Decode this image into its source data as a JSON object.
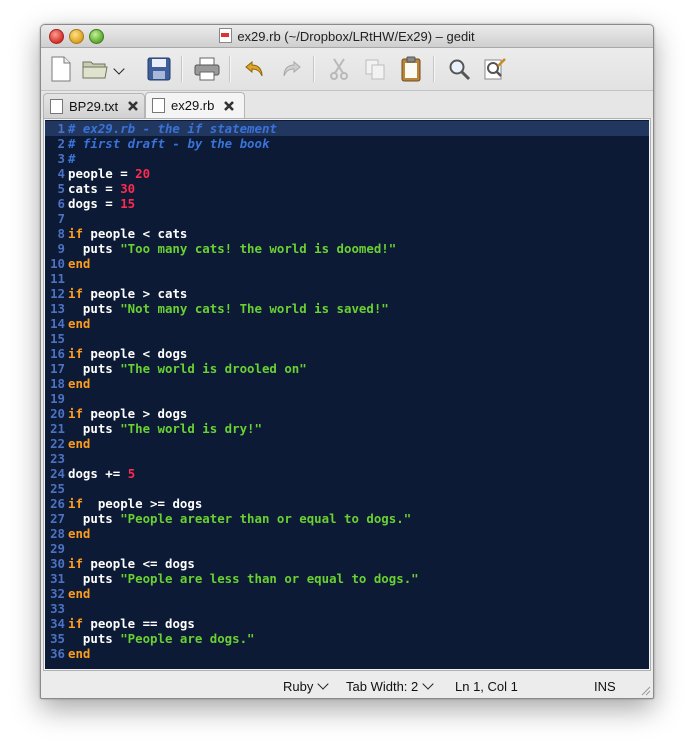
{
  "window": {
    "title": "ex29.rb (~/Dropbox/LRtHW/Ex29) – gedit"
  },
  "toolbar": {
    "buttons": [
      "new-document",
      "open",
      "open-dropdown",
      "save",
      "print",
      "undo",
      "redo",
      "cut",
      "copy",
      "paste",
      "find",
      "find-replace"
    ]
  },
  "tabs": [
    {
      "label": "BP29.txt",
      "active": false
    },
    {
      "label": "ex29.rb",
      "active": true
    }
  ],
  "editor": {
    "current_line": 1,
    "lines": [
      [
        [
          "c",
          "# ex29.rb - the if statement"
        ]
      ],
      [
        [
          "c",
          "# first draft - by the book"
        ]
      ],
      [
        [
          "c",
          "#"
        ]
      ],
      [
        [
          "i",
          "people = "
        ],
        [
          "n",
          "20"
        ]
      ],
      [
        [
          "i",
          "cats = "
        ],
        [
          "n",
          "30"
        ]
      ],
      [
        [
          "i",
          "dogs = "
        ],
        [
          "n",
          "15"
        ]
      ],
      [],
      [
        [
          "k",
          "if"
        ],
        [
          "i",
          " people < cats"
        ]
      ],
      [
        [
          "i",
          "  puts "
        ],
        [
          "s",
          "\"Too many cats! the world is doomed!\""
        ]
      ],
      [
        [
          "k",
          "end"
        ]
      ],
      [],
      [
        [
          "k",
          "if"
        ],
        [
          "i",
          " people > cats"
        ]
      ],
      [
        [
          "i",
          "  puts "
        ],
        [
          "s",
          "\"Not many cats! The world is saved!\""
        ]
      ],
      [
        [
          "k",
          "end"
        ]
      ],
      [],
      [
        [
          "k",
          "if"
        ],
        [
          "i",
          " people < dogs"
        ]
      ],
      [
        [
          "i",
          "  puts "
        ],
        [
          "s",
          "\"The world is drooled on\""
        ]
      ],
      [
        [
          "k",
          "end"
        ]
      ],
      [],
      [
        [
          "k",
          "if"
        ],
        [
          "i",
          " people > dogs"
        ]
      ],
      [
        [
          "i",
          "  puts "
        ],
        [
          "s",
          "\"The world is dry!\""
        ]
      ],
      [
        [
          "k",
          "end"
        ]
      ],
      [],
      [
        [
          "i",
          "dogs += "
        ],
        [
          "n",
          "5"
        ]
      ],
      [],
      [
        [
          "k",
          "if"
        ],
        [
          "i",
          "  people >= dogs"
        ]
      ],
      [
        [
          "i",
          "  puts "
        ],
        [
          "s",
          "\"People areater than or equal to dogs.\""
        ]
      ],
      [
        [
          "k",
          "end"
        ]
      ],
      [],
      [
        [
          "k",
          "if"
        ],
        [
          "i",
          " people <= dogs"
        ]
      ],
      [
        [
          "i",
          "  puts "
        ],
        [
          "s",
          "\"People are less than or equal to dogs.\""
        ]
      ],
      [
        [
          "k",
          "end"
        ]
      ],
      [],
      [
        [
          "k",
          "if"
        ],
        [
          "i",
          " people == dogs"
        ]
      ],
      [
        [
          "i",
          "  puts "
        ],
        [
          "s",
          "\"People are dogs.\""
        ]
      ],
      [
        [
          "k",
          "end"
        ]
      ]
    ]
  },
  "statusbar": {
    "language": "Ruby",
    "tab_width": "Tab Width:  2",
    "position": "Ln 1, Col 1",
    "mode": "INS"
  },
  "colors": {
    "editor_bg": "#0c1a35",
    "comment": "#3a73d8",
    "keyword": "#ff9c1b",
    "number": "#ff2a4f",
    "string": "#69d132",
    "line_number": "#4c72c2"
  }
}
